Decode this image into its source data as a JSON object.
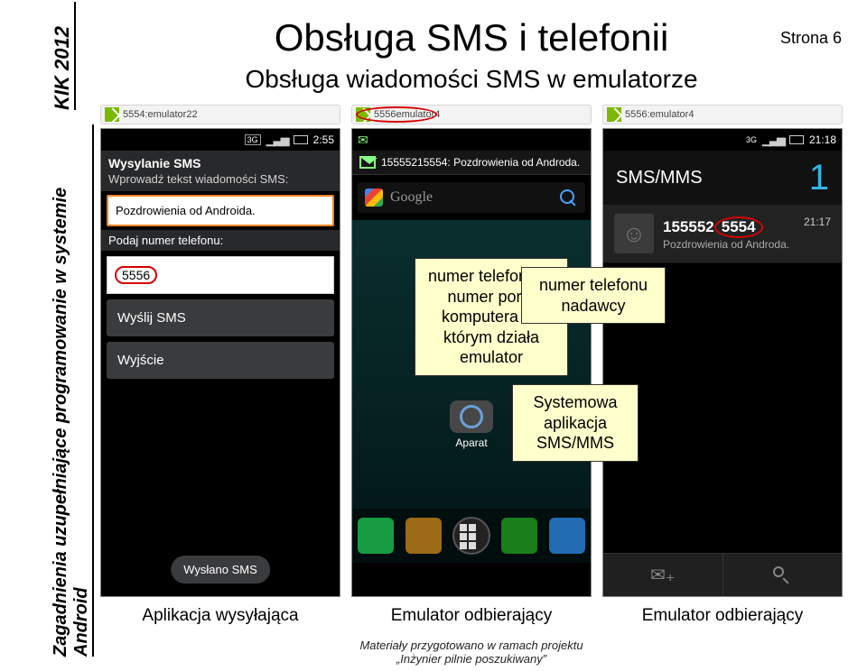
{
  "sidebar": {
    "kik": "KIK 2012",
    "topic": "Zagadnienia uzupełniające programowanie w systemie Android"
  },
  "title": "Obsługa SMS i telefonii",
  "subtitle": "Obsługa wiadomości SMS w emulatorze",
  "page": "Strona 6",
  "tabs": {
    "t1": "5554:emulator22",
    "t2": "5556emulator4",
    "t3": "5556:emulator4"
  },
  "phone1": {
    "time": "2:55",
    "header": "Wysylanie SMS",
    "prompt": "Wprowadź tekst wiadomości SMS:",
    "msg": "Pozdrowienia od Androida.",
    "numlabel": "Podaj numer telefonu:",
    "num": "5556",
    "btn_send": "Wyślij SMS",
    "btn_exit": "Wyjście",
    "toast": "Wysłano SMS"
  },
  "phone2": {
    "notif": "15555215554: Pozdrowienia od Androda.",
    "google": "Google",
    "camera": "Aparat"
  },
  "phone3": {
    "time": "21:18",
    "header": "SMS/MMS",
    "count": "1",
    "sender_prefix": "155552",
    "sender_ring": "5554",
    "snippet": "Pozdrowienia od Androda.",
    "msg_time": "21:17"
  },
  "callouts": {
    "c1": "numer telefonu to numer portu komputera na którym działa emulator",
    "c2": "numer telefonu nadawcy",
    "c3": "Systemowa aplikacja SMS/MMS"
  },
  "captions": {
    "c1": "Aplikacja wysyłająca",
    "c2": "Emulator odbierający",
    "c3": "Emulator odbierający"
  },
  "footer": {
    "line1": "Materiały przygotowano w ramach projektu",
    "line2": "„Inżynier pilnie poszukiwany”"
  }
}
